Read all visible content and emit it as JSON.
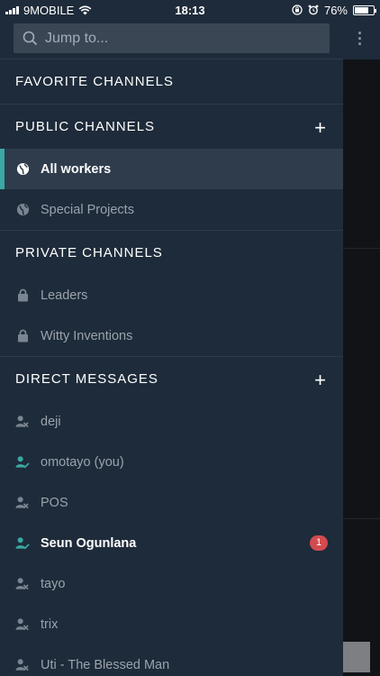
{
  "status": {
    "carrier": "9MOBILE",
    "time": "18:13",
    "battery": "76%",
    "battery_level": 0.76
  },
  "search": {
    "placeholder": "Jump to..."
  },
  "sections": {
    "favorites": "FAVORITE CHANNELS",
    "public": "PUBLIC CHANNELS",
    "private": "PRIVATE CHANNELS",
    "direct": "DIRECT MESSAGES"
  },
  "public_channels": [
    "All workers",
    "Special Projects"
  ],
  "private_channels": [
    "Leaders",
    "Witty Inventions"
  ],
  "direct_messages": [
    {
      "name": "deji",
      "status": "offline"
    },
    {
      "name": "omotayo (you)",
      "status": "online"
    },
    {
      "name": "POS",
      "status": "offline"
    },
    {
      "name": "Seun Ogunlana",
      "status": "online",
      "unread": "1"
    },
    {
      "name": "tayo",
      "status": "offline"
    },
    {
      "name": "trix",
      "status": "offline"
    },
    {
      "name": "Uti - The Blessed Man",
      "status": "offline"
    }
  ],
  "colors": {
    "sidebar_bg": "#1e2b3a",
    "active_bg": "#2e3c4c",
    "accent": "#3aa8a3",
    "badge": "#d24b4e"
  }
}
